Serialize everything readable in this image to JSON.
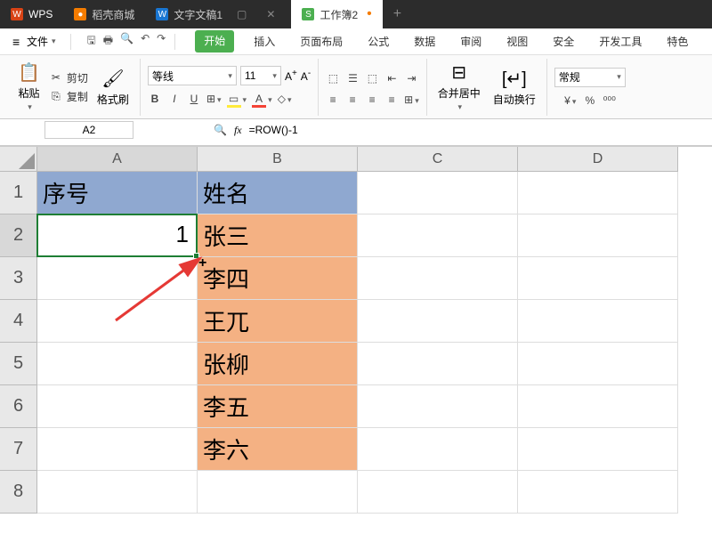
{
  "tabs": [
    {
      "label": "WPS",
      "icon": "W"
    },
    {
      "label": "稻壳商城",
      "icon": "●"
    },
    {
      "label": "文字文稿1",
      "icon": "W"
    },
    {
      "label": "工作簿2",
      "icon": "S",
      "active": true
    }
  ],
  "menu": {
    "file": "文件",
    "items": [
      "开始",
      "插入",
      "页面布局",
      "公式",
      "数据",
      "审阅",
      "视图",
      "安全",
      "开发工具",
      "特色"
    ]
  },
  "ribbon": {
    "paste": "粘贴",
    "cut": "剪切",
    "copy": "复制",
    "format_painter": "格式刷",
    "font_name": "等线",
    "font_size": "11",
    "merge_center": "合并居中",
    "wrap_text": "自动换行",
    "number_format": "常规"
  },
  "formula_bar": {
    "namebox": "A2",
    "formula": "=ROW()-1"
  },
  "columns": [
    "A",
    "B",
    "C",
    "D"
  ],
  "rows": [
    "1",
    "2",
    "3",
    "4",
    "5",
    "6",
    "7",
    "8"
  ],
  "cells": {
    "A1": "序号",
    "B1": "姓名",
    "A2": "1",
    "B2": "张三",
    "B3": "李四",
    "B4": "王兀",
    "B5": "张柳",
    "B6": "李五",
    "B7": "李六"
  },
  "chart_data": {
    "type": "table",
    "headers": [
      "序号",
      "姓名"
    ],
    "rows": [
      [
        1,
        "张三"
      ],
      [
        null,
        "李四"
      ],
      [
        null,
        "王兀"
      ],
      [
        null,
        "张柳"
      ],
      [
        null,
        "李五"
      ],
      [
        null,
        "李六"
      ]
    ]
  }
}
